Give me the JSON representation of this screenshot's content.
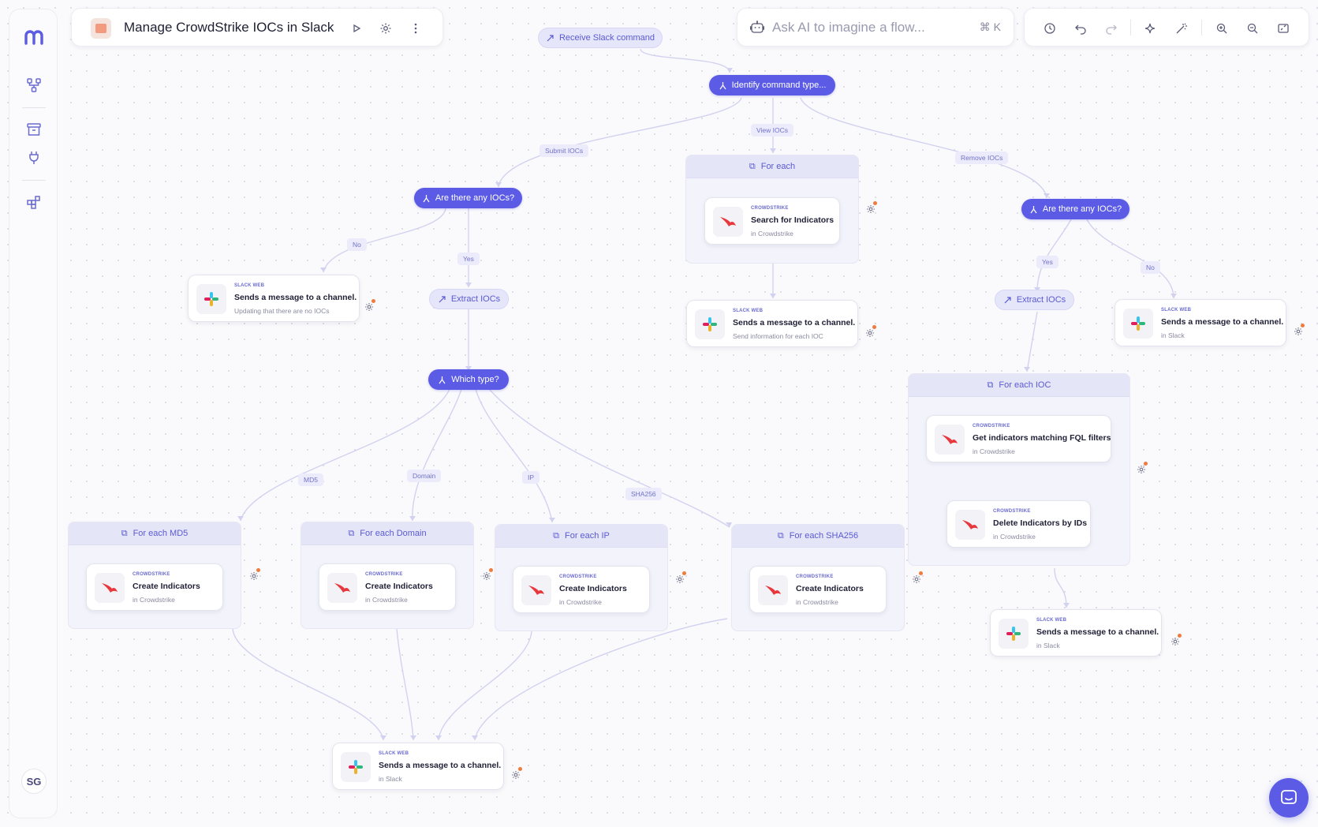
{
  "sidebar": {
    "avatar_initials": "SG"
  },
  "header": {
    "flow_title": "Manage CrowdStrike IOCs in Slack"
  },
  "ai_bar": {
    "placeholder": "Ask AI to imagine a flow...",
    "shortcut": "⌘ K"
  },
  "nodes": {
    "receive_slack": "Receive Slack command",
    "identify_type": "Identify command type...",
    "any_iocs_left": "Are there any IOCs?",
    "any_iocs_right": "Are there any IOCs?",
    "extract_left": "Extract IOCs",
    "extract_right": "Extract IOCs",
    "which_type": "Which type?"
  },
  "edge_labels": {
    "submit": "Submit IOCs",
    "view": "View IOCs",
    "remove": "Remove IOCs",
    "no_left": "No",
    "yes_left": "Yes",
    "yes_right": "Yes",
    "no_right": "No",
    "md5": "MD5",
    "domain": "Domain",
    "ip": "IP",
    "sha256": "SHA256"
  },
  "containers": {
    "for_each_view": "For each",
    "for_each_ioc": "For each IOC",
    "for_each_md5": "For each MD5",
    "for_each_domain": "For each Domain",
    "for_each_ip": "For each IP",
    "for_each_sha256": "For each SHA256"
  },
  "cards": {
    "slack_no_iocs": {
      "app": "SLACK WEB",
      "title": "Sends a message to a channel.",
      "sub": "Updating that there are no IOCs"
    },
    "search_indicators": {
      "app": "CROWDSTRIKE",
      "title": "Search for Indicators",
      "sub": "in Crowdstrike"
    },
    "slack_view": {
      "app": "SLACK WEB",
      "title": "Sends a message to a channel.",
      "sub": "Send information for each IOC"
    },
    "slack_remove_no": {
      "app": "SLACK WEB",
      "title": "Sends a message to a channel.",
      "sub": "in Slack"
    },
    "get_indicators_fql": {
      "app": "CROWDSTRIKE",
      "title": "Get indicators matching FQL filters",
      "sub": "in Crowdstrike"
    },
    "delete_indicators": {
      "app": "CROWDSTRIKE",
      "title": "Delete Indicators by IDs",
      "sub": "in Crowdstrike"
    },
    "slack_remove_done": {
      "app": "SLACK WEB",
      "title": "Sends a message to a channel.",
      "sub": "in Slack"
    },
    "create_md5": {
      "app": "CROWDSTRIKE",
      "title": "Create Indicators",
      "sub": "in Crowdstrike"
    },
    "create_domain": {
      "app": "CROWDSTRIKE",
      "title": "Create Indicators",
      "sub": "in Crowdstrike"
    },
    "create_ip": {
      "app": "CROWDSTRIKE",
      "title": "Create Indicators",
      "sub": "in Crowdstrike"
    },
    "create_sha256": {
      "app": "CROWDSTRIKE",
      "title": "Create Indicators",
      "sub": "in Crowdstrike"
    },
    "slack_final": {
      "app": "SLACK WEB",
      "title": "Sends a message to a channel.",
      "sub": "in Slack"
    }
  },
  "colors": {
    "accent": "#5b5be6",
    "accent_light": "#e6e6fb",
    "status_dot": "#f07b3c",
    "crowdstrike_red": "#e8383d"
  }
}
